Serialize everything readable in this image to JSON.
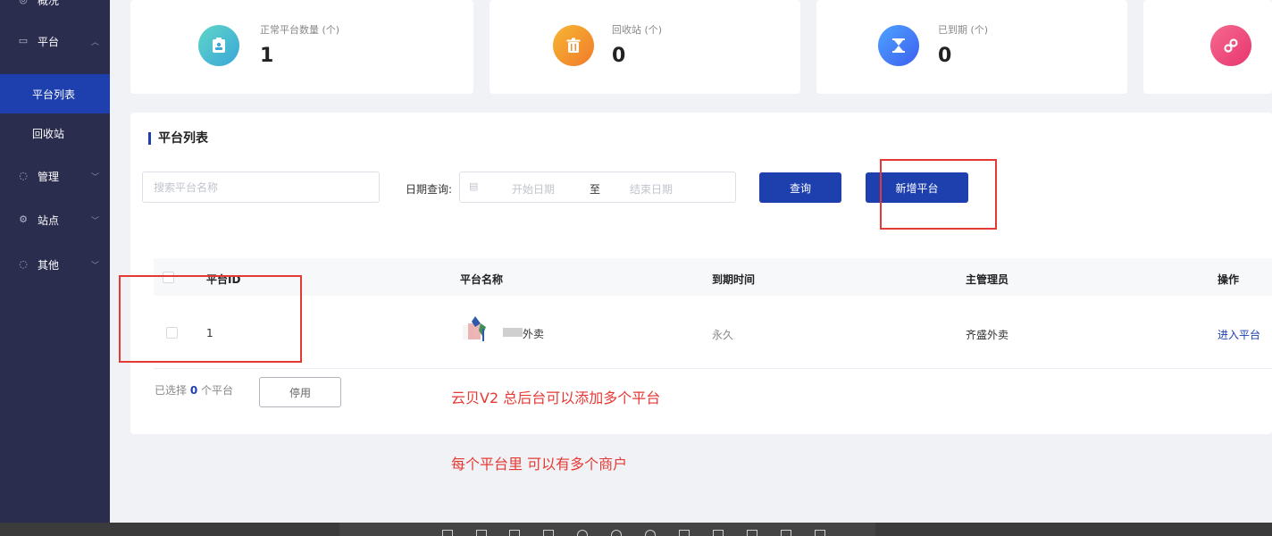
{
  "sidebar": {
    "items": [
      {
        "label": "概况",
        "icon": "overview-icon"
      },
      {
        "label": "平台",
        "icon": "chart-icon",
        "chevron": "up"
      },
      {
        "label": "平台列表",
        "active": true
      },
      {
        "label": "回收站"
      },
      {
        "label": "管理",
        "icon": "circle-icon",
        "chevron": "down"
      },
      {
        "label": "站点",
        "icon": "gear-icon",
        "chevron": "down"
      },
      {
        "label": "其他",
        "icon": "circle-icon",
        "chevron": "down"
      }
    ]
  },
  "stats": [
    {
      "label": "正常平台数量",
      "unit": "(个)",
      "value": "1",
      "icon": "clipboard-icon",
      "color": "#3bbcd0"
    },
    {
      "label": "回收站",
      "unit": "(个)",
      "value": "0",
      "icon": "trash-icon",
      "color": "#f19a2b"
    },
    {
      "label": "已到期",
      "unit": "(个)",
      "value": "0",
      "icon": "hourglass-icon",
      "color": "#3b72f0"
    },
    {
      "label": "",
      "unit": "",
      "value": "",
      "icon": "link-icon",
      "color": "#ec4d7d"
    }
  ],
  "panel": {
    "title": "平台列表",
    "search_placeholder": "搜索平台名称",
    "date_label": "日期查询:",
    "date_start": "开始日期",
    "date_sep": "至",
    "date_end": "结束日期",
    "query_btn": "查询",
    "add_btn": "新增平台"
  },
  "table": {
    "headers": [
      "平台ID",
      "平台名称",
      "到期时间",
      "主管理员",
      "操作"
    ],
    "rows": [
      {
        "id": "1",
        "name": "外卖",
        "expire": "永久",
        "admin": "齐盛外卖",
        "action": "进入平台"
      }
    ]
  },
  "footer": {
    "selected_prefix": "已选择",
    "selected_count": "0",
    "selected_suffix": "个平台",
    "disable_btn": "停用"
  },
  "annotations": {
    "note1": "云贝V2  总后台可以添加多个平台",
    "note2": "每个平台里 可以有多个商户"
  },
  "colors": {
    "primary": "#1e40af",
    "sidebar_bg": "#2b2d4f",
    "annotation_red": "#e53935"
  }
}
